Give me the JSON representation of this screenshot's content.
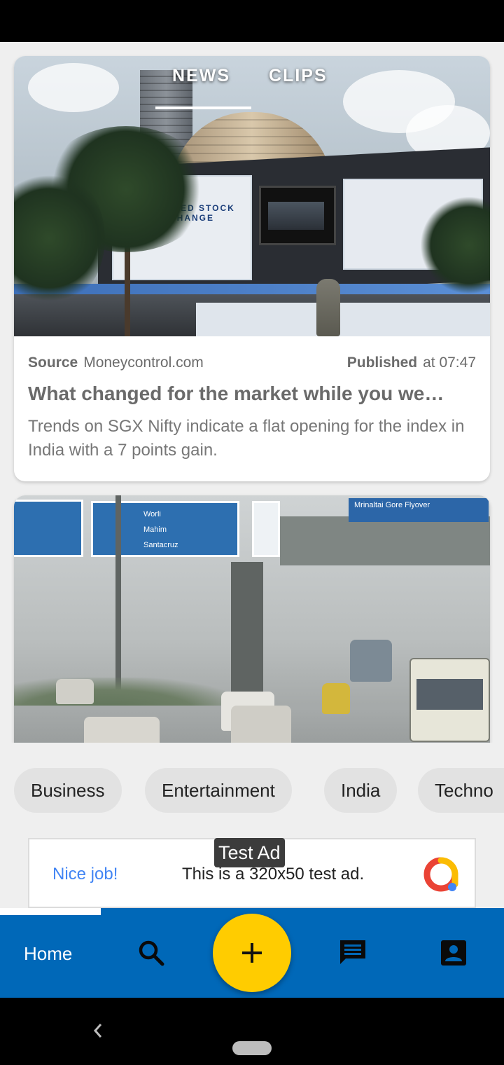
{
  "tabs": [
    {
      "label": "NEWS",
      "active": true
    },
    {
      "label": "CLIPS",
      "active": false
    }
  ],
  "article": {
    "source_label": "Source",
    "source": "Moneycontrol.com",
    "published_label": "Published",
    "published_time": "at 07:47",
    "headline": "What changed for the market while you we…",
    "summary": "Trends on SGX Nifty indicate a flat opening for the index in India with a 7 points gain."
  },
  "images": {
    "stock_exchange_banner": "UNITED STOCK EXCHANGE",
    "road_sign_1": "Worli",
    "road_sign_2": "Mahim",
    "road_sign_3": "Santacruz",
    "overpass_sign": "Mrinaltai Gore Flyover"
  },
  "categories": [
    "Business",
    "Entertainment",
    "India",
    "Techno"
  ],
  "ad": {
    "tag": "Test Ad",
    "nice": "Nice job!",
    "text": "This is a 320x50 test ad."
  },
  "bottom_nav": {
    "home_label": "Home",
    "icons": [
      "search-icon",
      "add-icon",
      "chat-icon",
      "profile-icon"
    ]
  },
  "colors": {
    "nav_bg": "#0068b8",
    "fab": "#ffcc00",
    "ad_link": "#4285f4"
  }
}
